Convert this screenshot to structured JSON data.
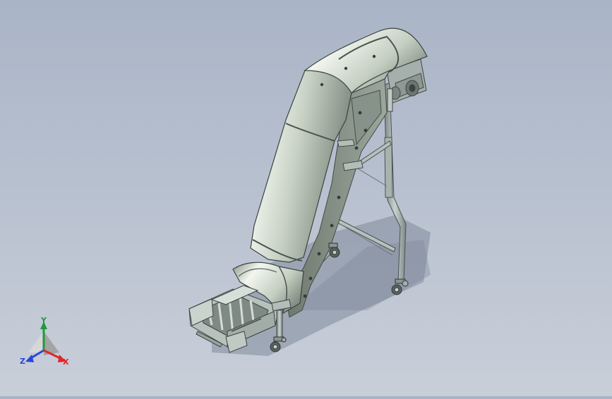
{
  "viewport": {
    "background_top": "#a9b4c6",
    "background_bottom": "#c9cfd9"
  },
  "model": {
    "subject": "inclined-belt-conveyor-3d-model",
    "body_color": "#c9d3c6",
    "body_highlight": "#f1f5ee",
    "body_shadow": "#6f7a73",
    "frame_color": "#9aa5a2",
    "shadow_color": "#7f8a9b"
  },
  "triad": {
    "x_label": "X",
    "y_label": "Y",
    "z_label": "Z",
    "x_color": "#e0262b",
    "y_color": "#1f9a3b",
    "z_color": "#2b47d8"
  }
}
